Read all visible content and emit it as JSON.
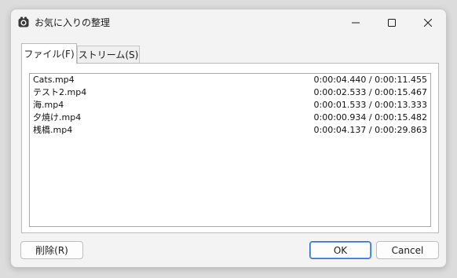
{
  "window": {
    "title": "お気に入りの整理",
    "app_icon": "camera-icon"
  },
  "titlebar_buttons": {
    "minimize": "minimize-icon",
    "maximize": "maximize-icon",
    "close": "close-icon"
  },
  "tabs": [
    {
      "label": "ファイル(F)",
      "active": true
    },
    {
      "label": "ストリーム(S)",
      "active": false
    }
  ],
  "files": [
    {
      "name": "Cats.mp4",
      "time": "0:00:04.440 / 0:00:11.455"
    },
    {
      "name": "テスト2.mp4",
      "time": "0:00:02.533 / 0:00:15.467"
    },
    {
      "name": "海.mp4",
      "time": "0:00:01.533 / 0:00:13.333"
    },
    {
      "name": "夕焼け.mp4",
      "time": "0:00:00.934 / 0:00:15.482"
    },
    {
      "name": "桟橋.mp4",
      "time": "0:00:04.137 / 0:00:29.863"
    }
  ],
  "buttons": {
    "delete_label": "削除(R)",
    "ok_label": "OK",
    "cancel_label": "Cancel"
  },
  "colors": {
    "ok_border": "#2a6fd6",
    "window_bg": "#f3f3f3"
  }
}
